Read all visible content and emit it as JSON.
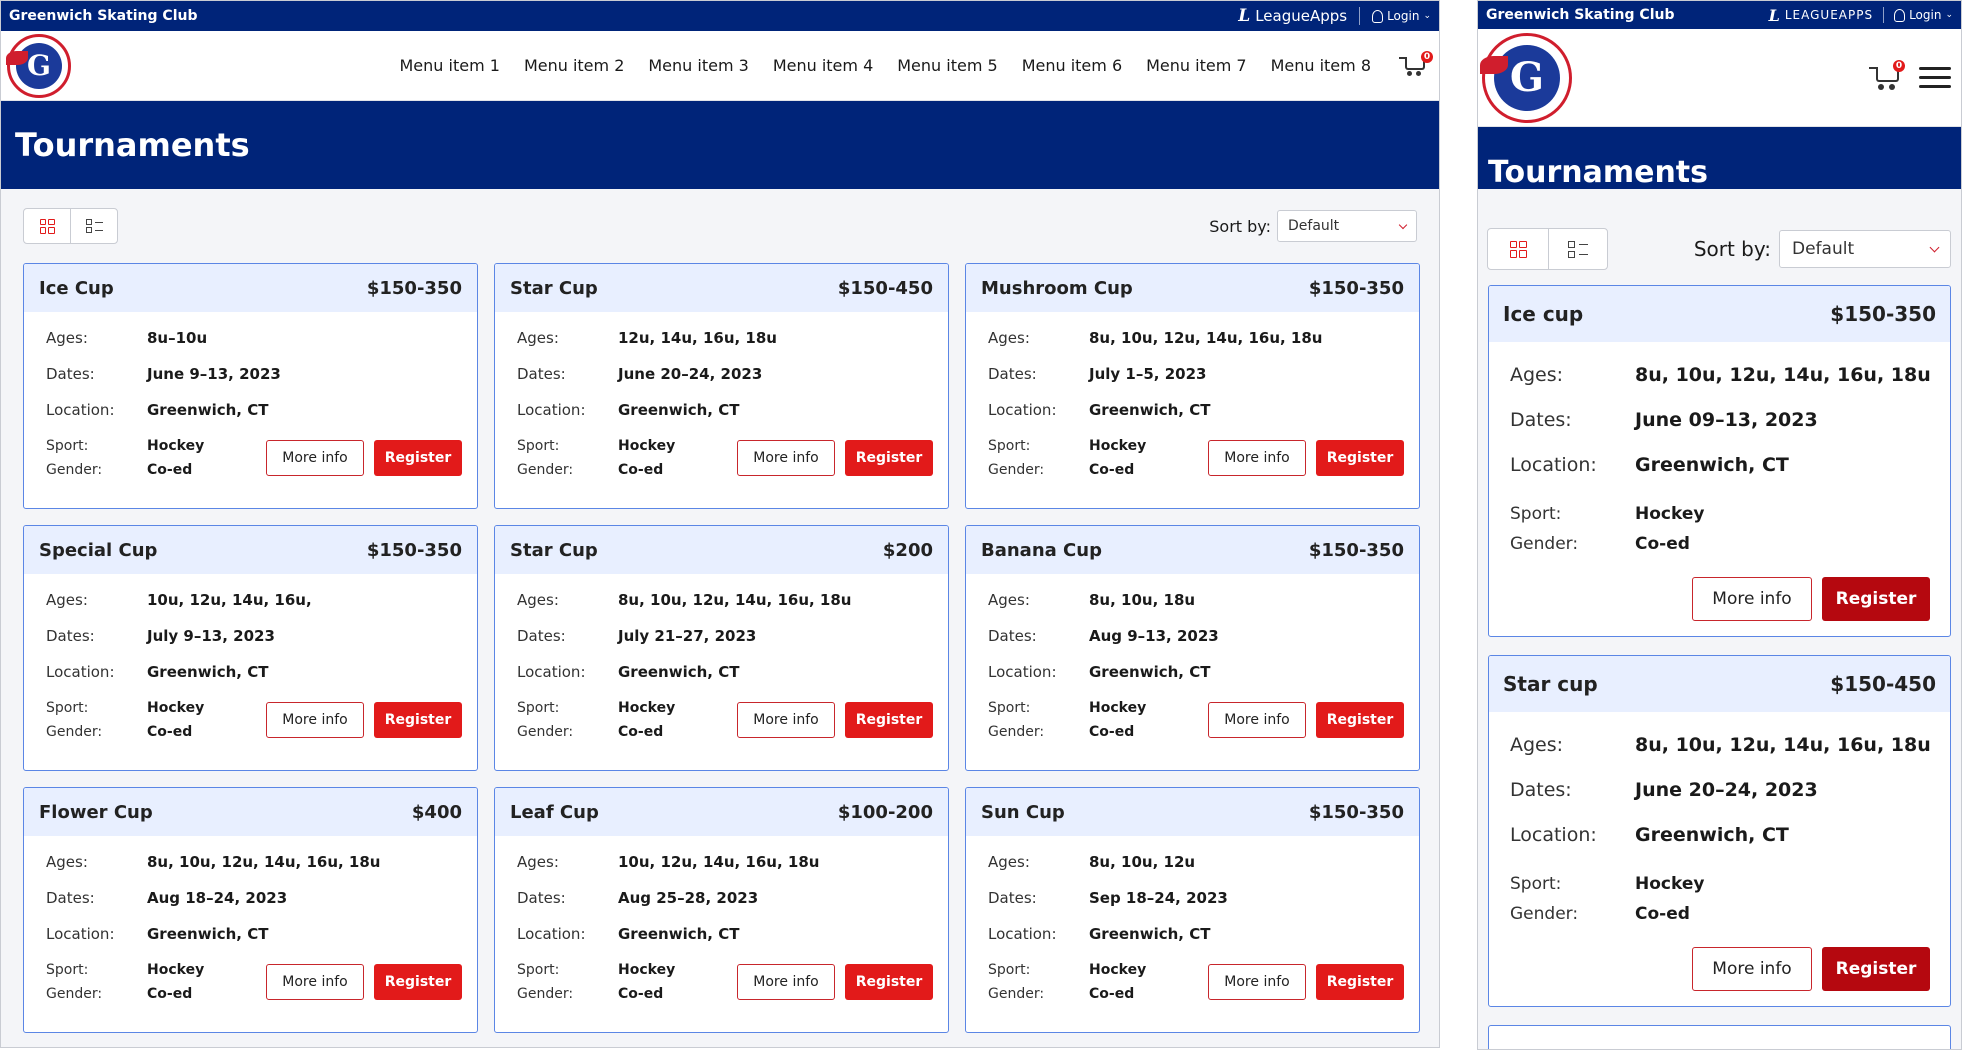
{
  "club_name": "Greenwich Skating Club",
  "leagueapps_label": "LeagueApps",
  "leagueapps_label_mobile": "LEAGUEAPPS",
  "login_label": "Login",
  "logo_letter": "G",
  "cart_count": "0",
  "menu_items": [
    "Menu item 1",
    "Menu item 2",
    "Menu item 3",
    "Menu item 4",
    "Menu item 5",
    "Menu item 6",
    "Menu item 7",
    "Menu item 8"
  ],
  "page_title": "Tournaments",
  "sort_label": "Sort by:",
  "sort_value": "Default",
  "labels": {
    "ages": "Ages:",
    "dates": "Dates:",
    "location": "Location:",
    "sport": "Sport:",
    "gender": "Gender:"
  },
  "buttons": {
    "more_info": "More info",
    "register": "Register"
  },
  "colors": {
    "brand_navy": "#002479",
    "accent_red": "#e21a1a",
    "register_mobile": "#b5080f",
    "card_border": "#5b86e5",
    "card_header": "#e8efff"
  },
  "desktop_tournaments": [
    {
      "name": "Ice Cup",
      "price": "$150-350",
      "ages": "8u–10u",
      "dates": "June 9–13, 2023",
      "location": "Greenwich, CT",
      "sport": "Hockey",
      "gender": "Co-ed"
    },
    {
      "name": "Star Cup",
      "price": "$150-450",
      "ages": "12u, 14u, 16u, 18u",
      "dates": "June 20–24, 2023",
      "location": "Greenwich, CT",
      "sport": "Hockey",
      "gender": "Co-ed"
    },
    {
      "name": "Mushroom Cup",
      "price": "$150-350",
      "ages": "8u, 10u, 12u, 14u, 16u, 18u",
      "dates": "July 1–5, 2023",
      "location": "Greenwich, CT",
      "sport": "Hockey",
      "gender": "Co-ed"
    },
    {
      "name": "Special Cup",
      "price": "$150-350",
      "ages": "10u, 12u, 14u, 16u,",
      "dates": "July 9–13, 2023",
      "location": "Greenwich, CT",
      "sport": "Hockey",
      "gender": "Co-ed"
    },
    {
      "name": "Star Cup",
      "price": "$200",
      "ages": "8u, 10u, 12u, 14u, 16u, 18u",
      "dates": "July 21–27, 2023",
      "location": "Greenwich, CT",
      "sport": "Hockey",
      "gender": "Co-ed"
    },
    {
      "name": "Banana Cup",
      "price": "$150-350",
      "ages": "8u, 10u, 18u",
      "dates": "Aug 9–13, 2023",
      "location": "Greenwich, CT",
      "sport": "Hockey",
      "gender": "Co-ed"
    },
    {
      "name": "Flower Cup",
      "price": "$400",
      "ages": "8u, 10u, 12u, 14u, 16u, 18u",
      "dates": "Aug 18–24, 2023",
      "location": "Greenwich, CT",
      "sport": "Hockey",
      "gender": "Co-ed"
    },
    {
      "name": "Leaf Cup",
      "price": "$100-200",
      "ages": "10u, 12u, 14u, 16u, 18u",
      "dates": "Aug 25–28, 2023",
      "location": "Greenwich, CT",
      "sport": "Hockey",
      "gender": "Co-ed"
    },
    {
      "name": "Sun Cup",
      "price": "$150-350",
      "ages": "8u, 10u, 12u",
      "dates": "Sep 18–24, 2023",
      "location": "Greenwich, CT",
      "sport": "Hockey",
      "gender": "Co-ed"
    }
  ],
  "mobile_tournaments": [
    {
      "name": "Ice cup",
      "price": "$150-350",
      "ages": "8u, 10u, 12u, 14u, 16u, 18u",
      "dates": "June 09–13, 2023",
      "location": "Greenwich, CT",
      "sport": "Hockey",
      "gender": "Co-ed"
    },
    {
      "name": "Star cup",
      "price": "$150-450",
      "ages": "8u, 10u, 12u, 14u, 16u, 18u",
      "dates": "June 20–24, 2023",
      "location": "Greenwich, CT",
      "sport": "Hockey",
      "gender": "Co-ed"
    }
  ]
}
